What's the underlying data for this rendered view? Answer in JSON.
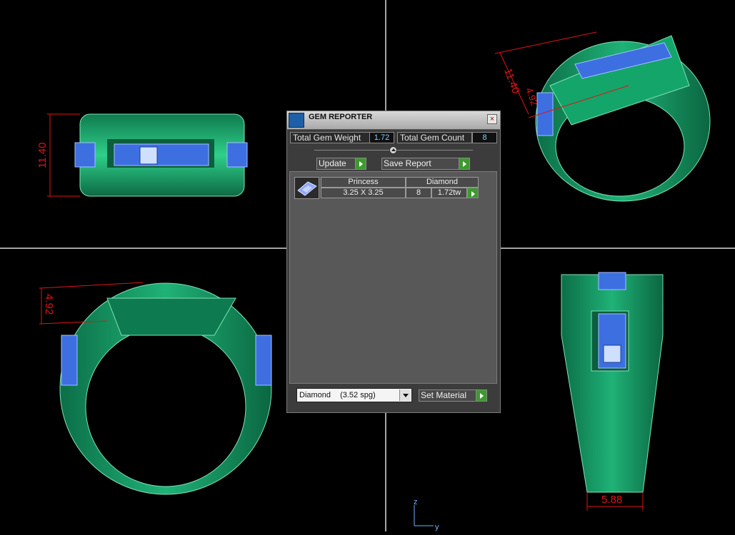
{
  "panel": {
    "title": "GEM REPORTER",
    "close_icon": "close-icon",
    "total_gem_weight_label": "Total Gem Weight",
    "total_gem_weight_value": "1.72",
    "total_gem_count_label": "Total Gem Count",
    "total_gem_count_value": "8",
    "update_label": "Update",
    "save_report_label": "Save Report",
    "table": {
      "headers": [
        "Princess",
        "Diamond"
      ],
      "row": {
        "size": "3.25 X 3.25",
        "count": "8",
        "weight": "1.72tw"
      }
    },
    "material_select": {
      "value": "Diamond",
      "density": "(3.52 spg)"
    },
    "set_material_label": "Set Material"
  },
  "viewports": {
    "front_dimension": "11.40",
    "iso_dimension_1": "11.40",
    "iso_dimension_2": "4.92",
    "side_dimension": "4.92",
    "top_dimension": "5.88",
    "axis_z": "z",
    "axis_y": "y"
  },
  "colors": {
    "ring": "#11965f",
    "gem": "#3d6fe0",
    "dimension": "#e01515",
    "grid": "#d9d9d9"
  }
}
